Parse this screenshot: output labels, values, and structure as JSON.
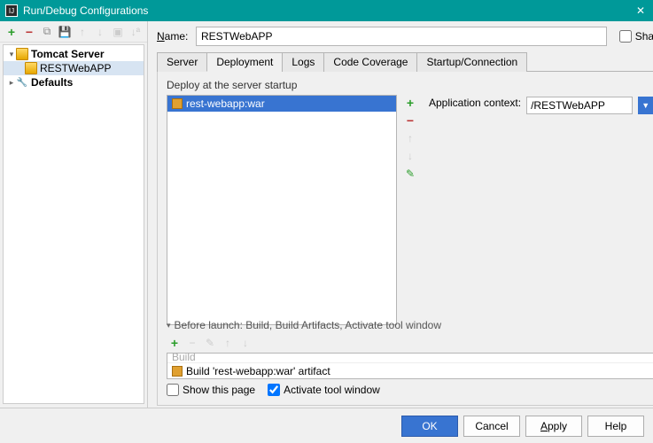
{
  "window": {
    "title": "Run/Debug Configurations"
  },
  "sidebar": {
    "items": [
      {
        "label": "Tomcat Server",
        "expanded": true,
        "bold": true,
        "hasIcon": true
      },
      {
        "label": "RESTWebAPP",
        "child": true,
        "selected": true,
        "hasIcon": true
      },
      {
        "label": "Defaults",
        "expanded": false,
        "bold": true
      }
    ]
  },
  "name": {
    "label_pre": "N",
    "label_rest": "ame:",
    "value": "RESTWebAPP",
    "share": "Share"
  },
  "tabs": [
    {
      "label": "Server"
    },
    {
      "label": "Deployment",
      "active": true
    },
    {
      "label": "Logs"
    },
    {
      "label": "Code Coverage"
    },
    {
      "label": "Startup/Connection"
    }
  ],
  "deployment": {
    "heading": "Deploy at the server startup",
    "items": [
      {
        "label": "rest-webapp:war"
      }
    ],
    "context_label": "Application context:",
    "context_value": "/RESTWebAPP"
  },
  "before_launch": {
    "header": "Before launch: Build, Build Artifacts, Activate tool window",
    "items": [
      {
        "label": "Build",
        "faded": true
      },
      {
        "label": "Build 'rest-webapp:war' artifact"
      }
    ],
    "show_page": "Show this page",
    "activate": "Activate tool window",
    "activate_checked": true
  },
  "footer": {
    "ok": "OK",
    "cancel": "Cancel",
    "apply_pre": "A",
    "apply_rest": "pply",
    "help": "Help"
  }
}
